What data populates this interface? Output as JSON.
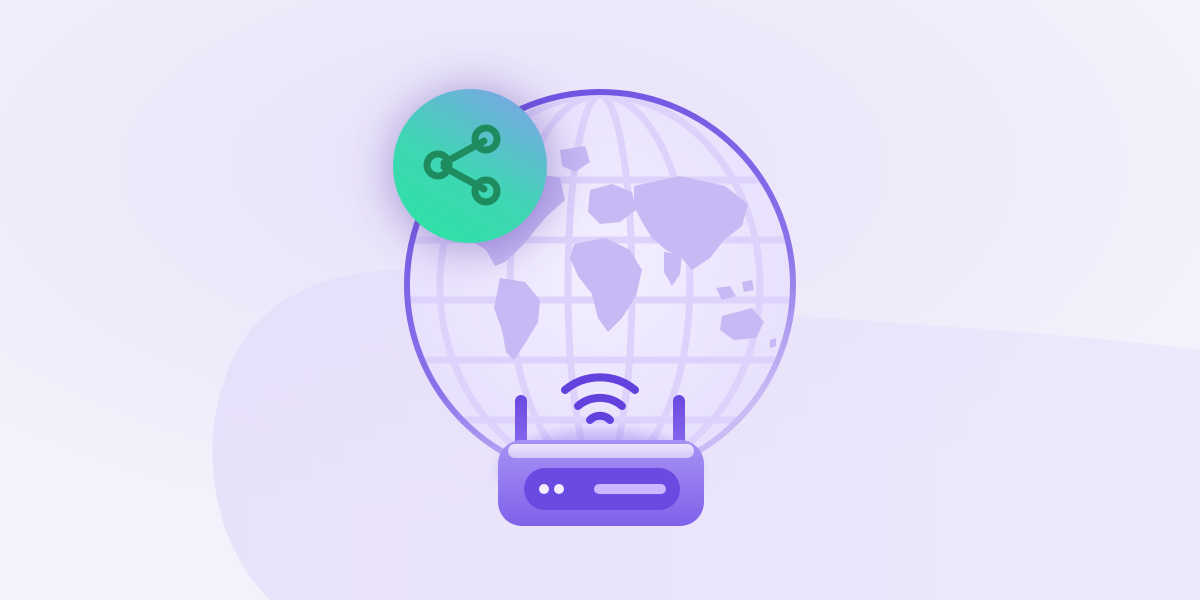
{
  "scene": {
    "background_color": "#f1eefb",
    "accent_colors": {
      "globe_ring": "#6a4de0",
      "globe_fill": "#ece6fd",
      "continents": "#c7b9f3",
      "router_body": "#8f72ee",
      "router_panel": "#6a4ae0",
      "router_indicator": "#c9b8ff",
      "wifi_waves": "#6241dd",
      "share_badge_top": "#7aa6e6",
      "share_badge_bottom": "#2ee1a6",
      "share_icon_stroke": "#1e8c5f"
    },
    "icons": [
      "share-icon",
      "globe-icon",
      "router-icon",
      "wifi-icon"
    ]
  }
}
